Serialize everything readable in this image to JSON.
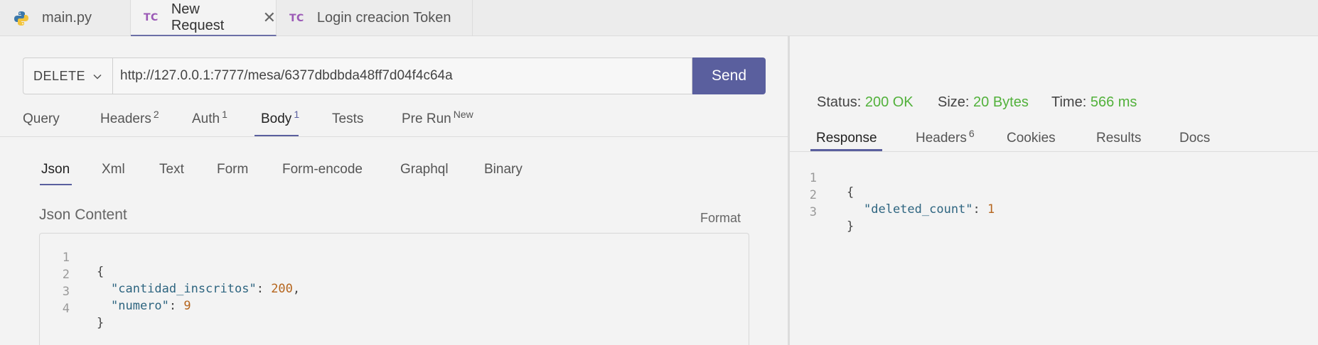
{
  "file_tabs": [
    {
      "label": "main.py",
      "icon": "python-icon"
    },
    {
      "label": "New Request",
      "badge": "TC",
      "active": true
    },
    {
      "label": "Login creacion Token",
      "badge": "TC"
    }
  ],
  "request": {
    "method": "DELETE",
    "url": "http://127.0.0.1:7777/mesa/6377dbdbda48ff7d04f4c64a",
    "send_label": "Send"
  },
  "request_tabs": [
    {
      "label": "Query",
      "count": ""
    },
    {
      "label": "Headers",
      "count": "2"
    },
    {
      "label": "Auth",
      "count": "1"
    },
    {
      "label": "Body",
      "count": "1"
    },
    {
      "label": "Tests",
      "count": ""
    },
    {
      "label": "Pre Run",
      "count": "New"
    }
  ],
  "body_tabs": [
    "Json",
    "Xml",
    "Text",
    "Form",
    "Form-encode",
    "Graphql",
    "Binary"
  ],
  "json_content": {
    "label": "Json Content",
    "format_label": "Format",
    "lines": [
      {
        "n": "1",
        "text": "{"
      },
      {
        "n": "2",
        "key": "\"cantidad_inscritos\"",
        "sep": ": ",
        "value": "200",
        "end": ","
      },
      {
        "n": "3",
        "key": "\"numero\"",
        "sep": ": ",
        "value": "9",
        "end": ""
      },
      {
        "n": "4",
        "text": "}"
      }
    ]
  },
  "response": {
    "status_label": "Status:",
    "status_value": "200 OK",
    "size_label": "Size:",
    "size_value": "20 Bytes",
    "time_label": "Time:",
    "time_value": "566 ms",
    "tabs": [
      {
        "label": "Response",
        "count": ""
      },
      {
        "label": "Headers",
        "count": "6"
      },
      {
        "label": "Cookies",
        "count": ""
      },
      {
        "label": "Results",
        "count": ""
      },
      {
        "label": "Docs",
        "count": ""
      }
    ],
    "lines": [
      {
        "n": "1",
        "text": "{"
      },
      {
        "n": "2",
        "key": "\"deleted_count\"",
        "sep": ": ",
        "value": "1"
      },
      {
        "n": "3",
        "text": "}"
      }
    ]
  },
  "colors": {
    "accent": "#5a5f9e",
    "success": "#52b13b",
    "badge": "#9b59b6"
  }
}
